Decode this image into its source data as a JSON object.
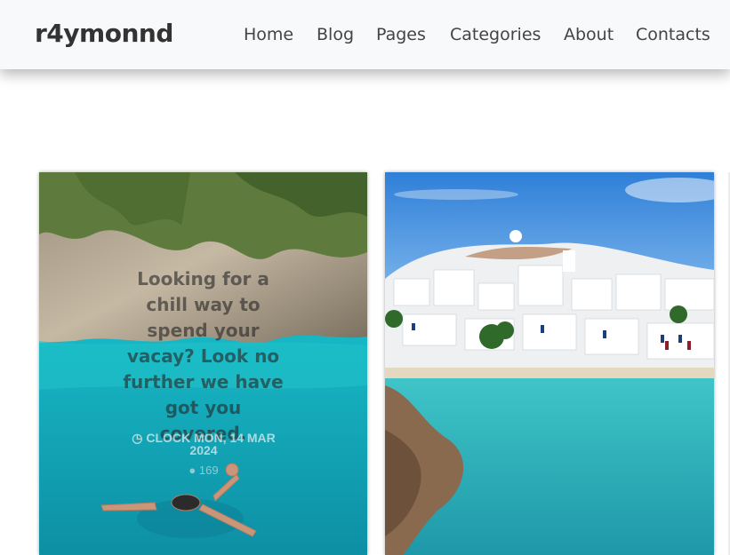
{
  "brand": "r4ymonnd",
  "nav": [
    "Home",
    "Blog",
    "Pages",
    "Categories",
    "About",
    "Contacts"
  ],
  "cards": [
    {
      "text": "Looking for a chill way to spend your vacay? Look no further we have got you covered.",
      "meta": "CLOCK MON, 14 MAR 2024",
      "views": "169"
    }
  ],
  "icons": {
    "clock": "clock-icon",
    "views": "eye-icon"
  }
}
